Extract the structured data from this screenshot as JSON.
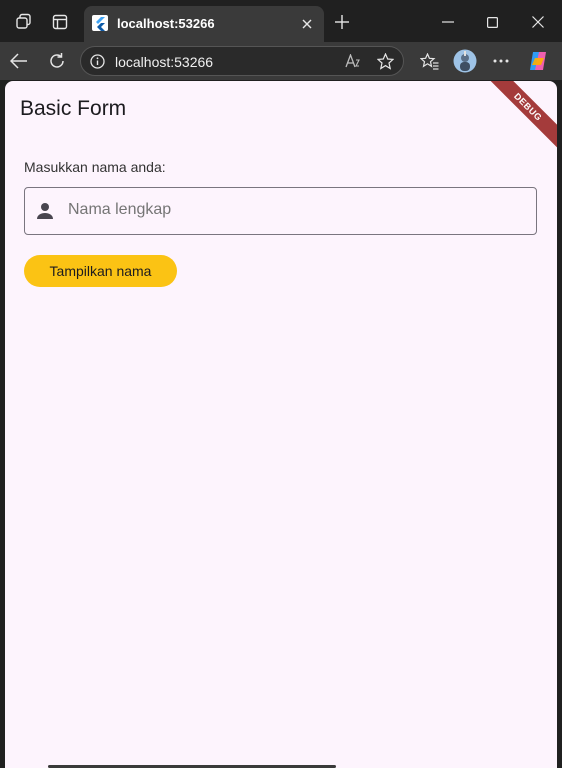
{
  "browser": {
    "tab_title": "localhost:53266",
    "url": "localhost:53266"
  },
  "app": {
    "title": "Basic Form",
    "debug_banner": "DEBUG",
    "form": {
      "label": "Masukkan nama anda:",
      "name_placeholder": "Nama lengkap",
      "name_value": "",
      "submit_label": "Tampilkan nama"
    }
  },
  "colors": {
    "page_background": "#fdf4fd",
    "button_background": "#fbc314",
    "debug_banner": "#a43b3b",
    "input_border": "#7a757f"
  }
}
